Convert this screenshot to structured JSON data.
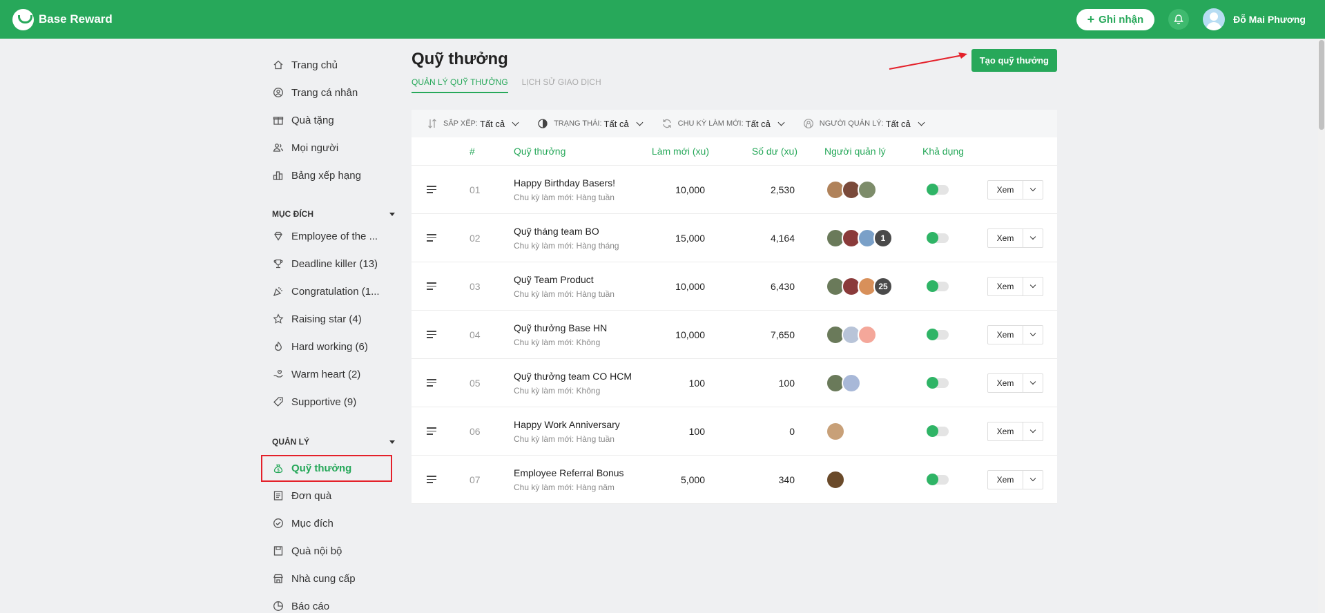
{
  "header": {
    "app_name": "Base Reward",
    "ack_button": "Ghi nhận",
    "bell_icon": "bell-icon",
    "user_name": "Đỗ Mai Phương"
  },
  "sidebar": {
    "top_items": [
      {
        "label": "Trang chủ",
        "icon": "home-icon"
      },
      {
        "label": "Trang cá nhân",
        "icon": "user-circle-icon"
      },
      {
        "label": "Quà tặng",
        "icon": "gift-icon"
      },
      {
        "label": "Mọi người",
        "icon": "people-icon"
      },
      {
        "label": "Bảng xếp hạng",
        "icon": "ranking-icon"
      }
    ],
    "purpose_header": "MỤC ĐÍCH",
    "purpose_items": [
      {
        "label": "Employee of the ...",
        "icon": "diamond-icon"
      },
      {
        "label": "Deadline killer (13)",
        "icon": "trophy-icon"
      },
      {
        "label": "Congratulation (1...",
        "icon": "party-icon"
      },
      {
        "label": "Raising star (4)",
        "icon": "star-icon"
      },
      {
        "label": "Hard working (6)",
        "icon": "fire-icon"
      },
      {
        "label": "Warm heart (2)",
        "icon": "hand-heart-icon"
      },
      {
        "label": "Supportive (9)",
        "icon": "tag-icon"
      }
    ],
    "manage_header": "QUẢN LÝ",
    "manage_items": [
      {
        "label": "Quỹ thưởng",
        "icon": "money-bag-icon",
        "active": true
      },
      {
        "label": "Đơn quà",
        "icon": "order-icon"
      },
      {
        "label": "Mục đích",
        "icon": "check-circle-icon"
      },
      {
        "label": "Quà nội bộ",
        "icon": "box-icon"
      },
      {
        "label": "Nhà cung cấp",
        "icon": "store-icon"
      },
      {
        "label": "Báo cáo",
        "icon": "report-icon"
      }
    ]
  },
  "main": {
    "title": "Quỹ thưởng",
    "tabs": [
      {
        "label": "QUẢN LÝ QUỸ THƯỞNG",
        "active": true
      },
      {
        "label": "LỊCH SỬ GIAO DỊCH",
        "active": false
      }
    ],
    "create_button": "Tạo quỹ thưởng",
    "filters": [
      {
        "label": "SẮP XẾP:",
        "value": "Tất cả",
        "icon": "sort-icon"
      },
      {
        "label": "TRẠNG THÁI:",
        "value": "Tất cả",
        "icon": "half-circle-icon"
      },
      {
        "label": "CHU KỲ LÀM MỚI:",
        "value": "Tất cả",
        "icon": "refresh-icon"
      },
      {
        "label": "NGƯỜI QUẢN LÝ:",
        "value": "Tất cả",
        "icon": "user-outline-icon"
      }
    ],
    "columns": {
      "num": "#",
      "name": "Quỹ thưởng",
      "reset": "Làm mới (xu)",
      "balance": "Số dư (xu)",
      "manager": "Người quản lý",
      "available": "Khả dụng"
    },
    "view_label": "Xem",
    "rows": [
      {
        "num": "01",
        "name": "Happy Birthday Basers!",
        "cycle": "Chu kỳ làm mới: Hàng tuần",
        "reset": "10,000",
        "balance": "2,530",
        "avatars": [
          "#b0825a",
          "#7a4a3a",
          "#7d8c6a"
        ],
        "extra": ""
      },
      {
        "num": "02",
        "name": "Quỹ tháng team BO",
        "cycle": "Chu kỳ làm mới: Hàng tháng",
        "reset": "15,000",
        "balance": "4,164",
        "avatars": [
          "#6a7a5a",
          "#8a3a3a",
          "#7aa0c8"
        ],
        "extra": "1"
      },
      {
        "num": "03",
        "name": "Quỹ Team Product",
        "cycle": "Chu kỳ làm mới: Hàng tuần",
        "reset": "10,000",
        "balance": "6,430",
        "avatars": [
          "#6a7a5a",
          "#8a3a3a",
          "#d8905a"
        ],
        "extra": "25"
      },
      {
        "num": "04",
        "name": "Quỹ thưởng Base HN",
        "cycle": "Chu kỳ làm mới: Không",
        "reset": "10,000",
        "balance": "7,650",
        "avatars": [
          "#6a7a5a",
          "#b8c4d8",
          "#f4a79a"
        ],
        "extra": ""
      },
      {
        "num": "05",
        "name": "Quỹ thưởng team CO HCM",
        "cycle": "Chu kỳ làm mới: Không",
        "reset": "100",
        "balance": "100",
        "avatars": [
          "#6a7a5a",
          "#a8b8d8"
        ],
        "extra": ""
      },
      {
        "num": "06",
        "name": "Happy Work Anniversary",
        "cycle": "Chu kỳ làm mới: Hàng tuần",
        "reset": "100",
        "balance": "0",
        "avatars": [
          "#c8a078"
        ],
        "extra": ""
      },
      {
        "num": "07",
        "name": "Employee Referral Bonus",
        "cycle": "Chu kỳ làm mới: Hàng năm",
        "reset": "5,000",
        "balance": "340",
        "avatars": [
          "#6a4a2a"
        ],
        "extra": ""
      }
    ]
  },
  "colors": {
    "brand": "#27a85a",
    "highlight": "#e4202a"
  }
}
